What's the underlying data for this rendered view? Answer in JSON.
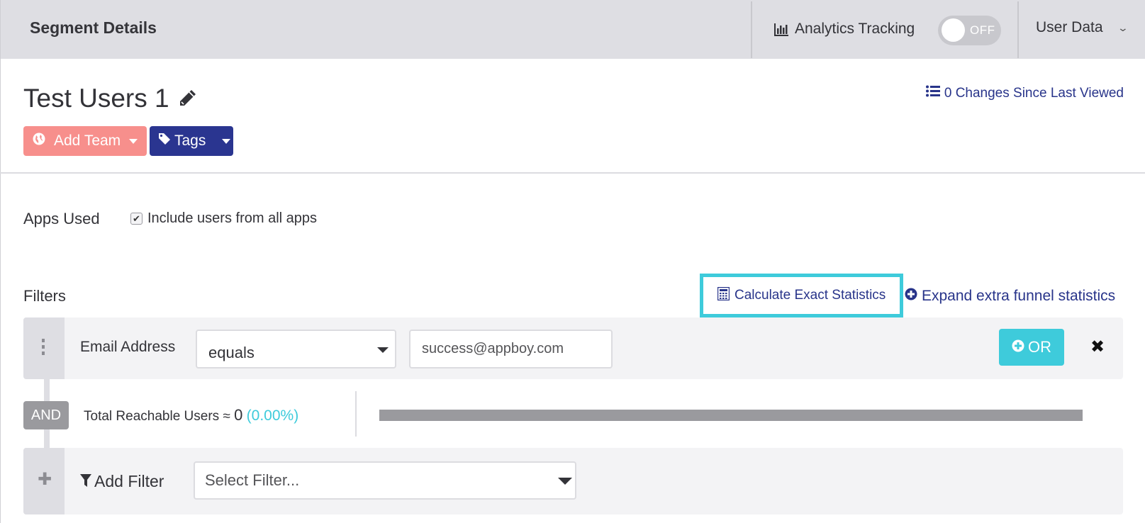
{
  "header": {
    "title": "Segment Details",
    "analytics_label": "Analytics Tracking",
    "analytics_icon": "bar-chart-icon",
    "toggle_state": "OFF",
    "user_data_label": "User Data",
    "user_data_icon": "chevron-down-icon"
  },
  "segment": {
    "name": "Test Users 1",
    "edit_icon": "pencil-icon",
    "changes_label": "0 Changes Since Last Viewed",
    "changes_icon": "list-icon",
    "add_team_label": "Add Team",
    "add_team_icon": "globe-icon",
    "tags_label": "Tags",
    "tags_icon": "tag-icon"
  },
  "apps_used": {
    "label": "Apps Used",
    "checkbox_label": "Include users from all apps",
    "checked": true
  },
  "filters": {
    "label": "Filters",
    "calculate_label": "Calculate Exact Statistics",
    "calculate_icon": "calculator-icon",
    "expand_label": "Expand extra funnel statistics",
    "expand_icon": "plus-circle-icon",
    "rows": [
      {
        "field": "Email Address",
        "operator": "equals",
        "value": "success@appboy.com",
        "or_label": "OR",
        "remove_icon": "close-icon"
      }
    ],
    "and_label": "AND",
    "reachable": {
      "label": "Total Reachable Users ≈",
      "count": "0",
      "percent": "(0.00%)",
      "fraction": 0
    },
    "add_filter_label": "Add Filter",
    "add_filter_icon": "filter-icon",
    "select_placeholder": "Select Filter..."
  },
  "colors": {
    "accent_teal": "#3ecbdb",
    "navy": "#2a3590",
    "salmon": "#f78f8c",
    "header_bg": "#dedee3"
  }
}
